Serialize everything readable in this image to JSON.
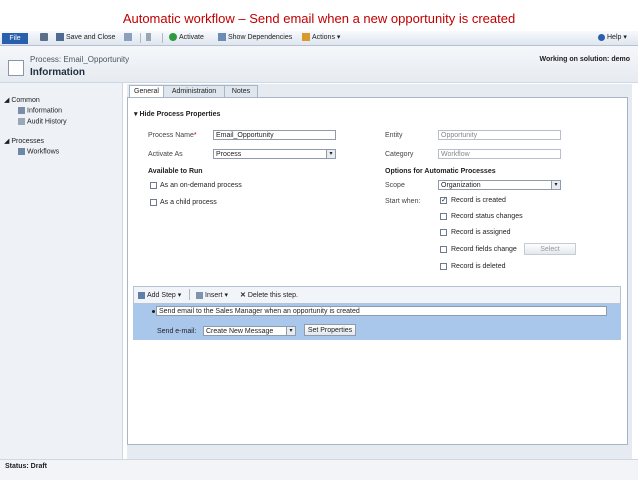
{
  "caption": "Automatic workflow – Send email when a new opportunity is created",
  "ribbon": {
    "file": "File",
    "save_close": "Save and Close",
    "activate": "Activate",
    "show_dependencies": "Show Dependencies",
    "actions": "Actions ▾",
    "help": "Help ▾"
  },
  "header": {
    "process_line": "Process: Email_Opportunity",
    "title": "Information",
    "working_on": "Working on solution: demo"
  },
  "nav": {
    "common": "Common",
    "information": "Information",
    "audit_history": "Audit History",
    "processes": "Processes",
    "workflows": "Workflows"
  },
  "tabs": [
    "General",
    "Administration",
    "Notes"
  ],
  "section": {
    "title": "Hide Process Properties"
  },
  "form": {
    "process_name_label": "Process Name",
    "required_mark": "*",
    "process_name_value": "Email_Opportunity",
    "activate_as_label": "Activate As",
    "activate_as_value": "Process",
    "available_to_run": "Available to Run",
    "on_demand": "As an on-demand process",
    "child_process": "As a child process",
    "entity_label": "Entity",
    "entity_value": "Opportunity",
    "category_label": "Category",
    "category_value": "Workflow",
    "options_title": "Options for Automatic Processes",
    "scope_label": "Scope",
    "scope_value": "Organization",
    "start_when_label": "Start when:",
    "record_created": "Record is created",
    "record_status": "Record status changes",
    "record_assigned": "Record is assigned",
    "record_fields": "Record fields change",
    "select_button": "Select",
    "record_deleted": "Record is deleted",
    "check_mark": "✓"
  },
  "steps": {
    "add_step": "Add Step ▾",
    "insert": "Insert ▾",
    "delete": "Delete this step.",
    "step_description": "Send email to the Sales Manager when an opportunity is created",
    "send_email_label": "Send e-mail:",
    "send_email_value": "Create New Message",
    "set_properties": "Set Properties"
  },
  "status": {
    "text": "Status: Draft"
  },
  "colors": {
    "caption": "#c00000",
    "file_button": "#2a5fae",
    "step_band": "#a9c7ea"
  }
}
